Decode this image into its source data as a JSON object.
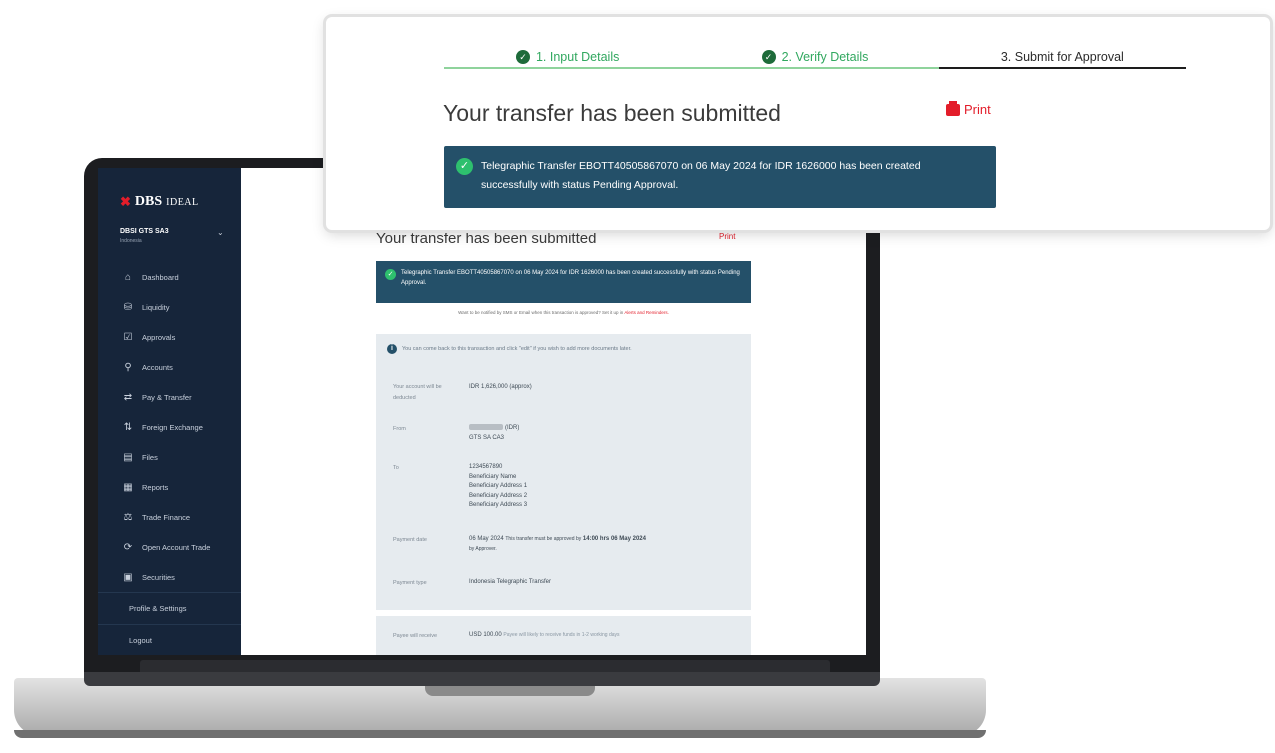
{
  "brand": {
    "logo_mark": "✖",
    "logo_name": "DBS",
    "logo_product": "IDEAL"
  },
  "account": {
    "name": "DBSI GTS SA3",
    "country": "Indonesia"
  },
  "sidebar": {
    "items": [
      {
        "label": "Dashboard",
        "icon": "home-icon"
      },
      {
        "label": "Liquidity",
        "icon": "liquidity-icon"
      },
      {
        "label": "Approvals",
        "icon": "approvals-icon"
      },
      {
        "label": "Accounts",
        "icon": "accounts-icon"
      },
      {
        "label": "Pay & Transfer",
        "icon": "transfer-icon"
      },
      {
        "label": "Foreign Exchange",
        "icon": "exchange-icon"
      },
      {
        "label": "Files",
        "icon": "files-icon"
      },
      {
        "label": "Reports",
        "icon": "reports-icon"
      },
      {
        "label": "Trade Finance",
        "icon": "trade-finance-icon"
      },
      {
        "label": "Open Account Trade",
        "icon": "open-account-icon"
      },
      {
        "label": "Securities",
        "icon": "securities-icon"
      }
    ],
    "profile_label": "Profile & Settings",
    "logout_label": "Logout"
  },
  "steps": [
    {
      "label": "1. Input Details",
      "status": "done"
    },
    {
      "label": "2. Verify Details",
      "status": "done"
    },
    {
      "label": "3. Submit for Approval",
      "status": "active"
    }
  ],
  "page": {
    "title": "Your transfer has been submitted",
    "print_label": "Print",
    "success_message": "Telegraphic Transfer EBOTT40505867070 on 06 May 2024 for IDR 1626000 has been created successfully with status Pending Approval.",
    "notify_text": "Want to be notified by SMS or Email when this transaction is approved? Set it up in",
    "notify_link": "Alerts and Reminders.",
    "info_text": "You can come back to this transaction and click \"edit\" if you wish to add more documents later."
  },
  "details": {
    "deducted_label": "Your account will be deducted",
    "deducted_value": "IDR 1,626,000 (approx)",
    "from_label": "From",
    "from_currency": "(IDR)",
    "from_account": "GTS SA CA3",
    "to_label": "To",
    "to_account": "1234567890",
    "to_name": "Beneficiary Name",
    "to_address_1": "Beneficiary Address 1",
    "to_address_2": "Beneficiary Address 2",
    "to_address_3": "Beneficiary Address 3",
    "payment_date_label": "Payment date",
    "payment_date_value": "06 May 2024",
    "payment_date_note": "This transfer must be approved by",
    "payment_date_deadline": "14:00 hrs 06 May 2024",
    "payment_date_by": "by Approver.",
    "payment_type_label": "Payment type",
    "payment_type_value": "Indonesia Telegraphic Transfer",
    "payee_label": "Payee will receive",
    "payee_value": "USD 100.00",
    "payee_note": "Payee will likely to receive funds in 1-2 working days"
  },
  "colors": {
    "sidebar": "#16253a",
    "banner": "#245069",
    "accent_red": "#e31d2a",
    "step_done": "#31a85f"
  }
}
